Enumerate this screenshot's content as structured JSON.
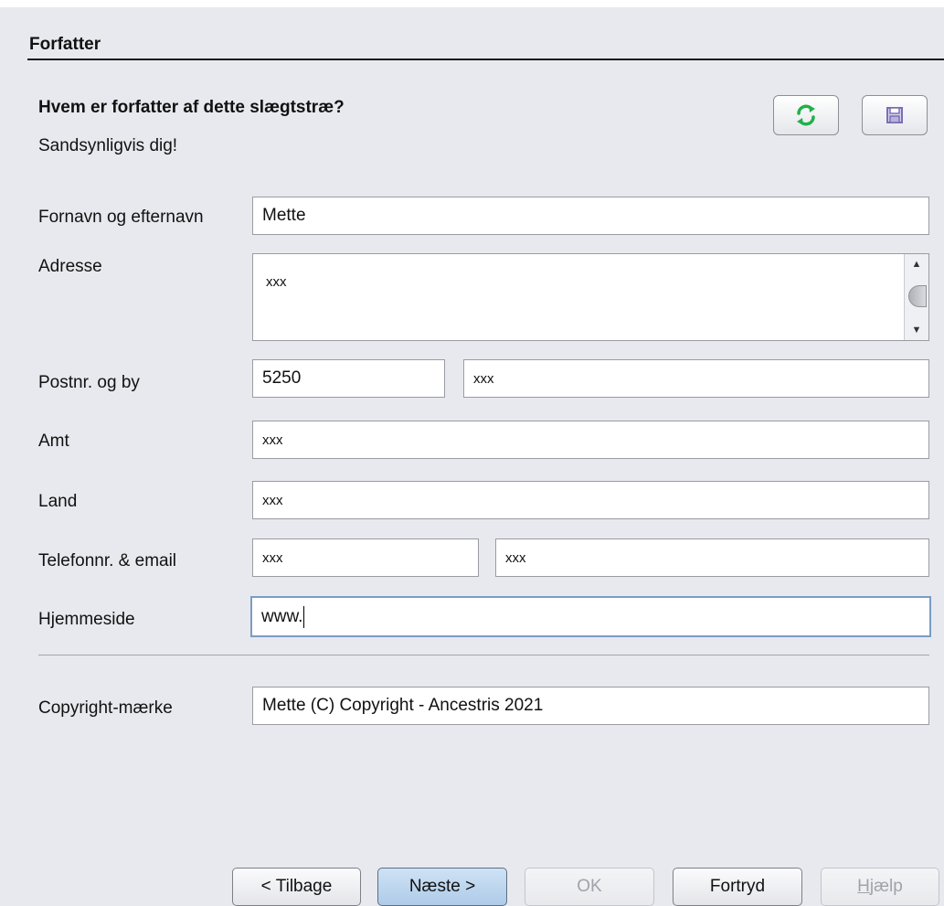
{
  "section": {
    "title": "Forfatter"
  },
  "question": "Hvem er forfatter af dette slægtstræ?",
  "hint": "Sandsynligvis dig!",
  "toolbar": {
    "refresh_icon": "refresh-icon",
    "save_icon": "save-icon"
  },
  "fields": {
    "name": {
      "label": "Fornavn og efternavn",
      "value": "Mette"
    },
    "address": {
      "label": "Adresse",
      "value": "xxx"
    },
    "postcode_city": {
      "label": "Postnr. og by",
      "postcode": "5250",
      "city": "xxx"
    },
    "county": {
      "label": "Amt",
      "value": "xxx"
    },
    "country": {
      "label": "Land",
      "value": "xxx"
    },
    "phone_email": {
      "label": "Telefonnr. & email",
      "phone": "xxx",
      "email": "xxx"
    },
    "homepage": {
      "label": "Hjemmeside",
      "value": "www."
    },
    "copyright": {
      "label": "Copyright-mærke",
      "value": "Mette (C) Copyright - Ancestris 2021"
    }
  },
  "buttons": {
    "back": "< Tilbage",
    "next": "Næste >",
    "ok": "OK",
    "cancel": "Fortryd",
    "help_underlined": "H",
    "help_rest": "jælp"
  },
  "colors": {
    "panel_bg": "#e8e9ee",
    "refresh_green": "#22b04b",
    "save_purple": "#7b6fb3",
    "primary_button": "#aecbe8"
  }
}
